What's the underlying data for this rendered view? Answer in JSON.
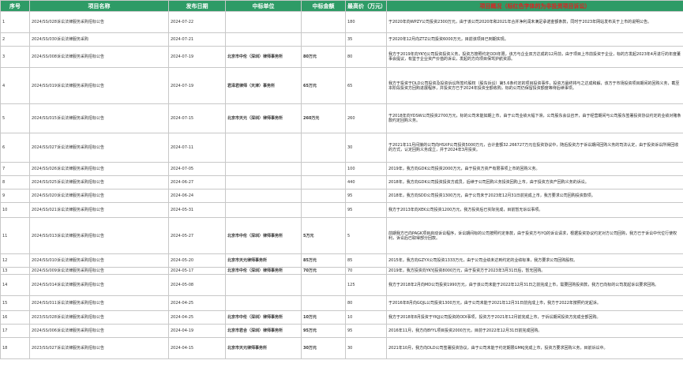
{
  "header": {
    "no": "序号",
    "name": "项目名称",
    "date": "发布日期",
    "winner": "中标单位",
    "amount": "中标金额",
    "price": "最高价（万元）",
    "summary": "项目概况（标红色字体的为非投资项目诉讼）"
  },
  "rows": [
    {
      "no": "1",
      "name": "2024/SS/028诉讼法律服务采购招标公告",
      "date": "2024-07-22",
      "winner": "",
      "amount": "",
      "price": "180",
      "summary": "于2020年向WPZY公司投资2300万元，由于该公司2020年和2021年合并净利润未满足承诺金额条款，同时于2023年网站发布关于上市的说明公告。"
    },
    {
      "no": "2",
      "name": "2024/SS/030诉讼法律服务采购",
      "date": "2024-07-21",
      "winner": "",
      "amount": "",
      "price": "35",
      "summary": "于2020年12月向ZTZ公司投资6000万元，目前该项目已到期实现。"
    },
    {
      "no": "3",
      "name": "2024/SS/008诉讼法律服务采购招标公告",
      "date": "2024-07-19",
      "winner": "北京市中伦（深圳）律师事务所",
      "amount": "80万元",
      "price": "80",
      "summary": "我方于2019年向YKYJ公司投资投资义务，投资方按照约定ODI年限，该方与企业双方达成的12月前，由于项目上市前投资于企业，标的方发起2023年4月进行的年度董事会提议，有鉴于企业资产价值的诉讼，发起的方向项目保驾护航资源。"
    },
    {
      "no": "4",
      "name": "2024/SS/019诉讼法律服务采购招标公告",
      "date": "2024-07-19",
      "winner": "君泽君律师（天津）事务所",
      "amount": "65万元",
      "price": "65",
      "summary": "我方于投资于DLD公司投资及投资诉讼所签约股权（股东诉讼）第5.6条约定的项目投资事件，投资方最终将与之达成和解，该方于市场投资项目期间的回购义务，截至本阶段投资方回购进展程序，并投资方已于2024年投资全额收购，标的公司仍保留投资额度等待后续事项。"
    },
    {
      "no": "5",
      "name": "2024/SS/015诉讼法律服务采购招标公告",
      "date": "2024-07-15",
      "winner": "北京市天元（深圳）律师事务所",
      "amount": "260万元",
      "price": "260",
      "summary": "于2018年向YDSW公司投资2700万元，标的公司未能如期上市，由于公司业绩大幅下滑，公司股东会议召开，由于经营期间与公司股东签署投资协议约定的业绩对赌条款约定回购义务。"
    },
    {
      "no": "6",
      "name": "2024/SS/027诉讼法律服务采购招标公告",
      "date": "2024-07-11",
      "winner": "",
      "amount": "",
      "price": "30",
      "summary": "于2021年11月间接的公司向HSXP公司投资5000万元，合计金额32.266727万元在投资协议中，随后投资方于诉讼期间回购义务的司法认定，由于投资诉讼所得回收的方式，认定回购义务成立，并于2024年3月投资。"
    },
    {
      "no": "7",
      "name": "2024/SS/026诉讼法律服务采购招标公告",
      "date": "2024-07-05",
      "winner": "",
      "amount": "",
      "price": "100",
      "summary": "2019年，我方向GDK公司投资2000万元，由于投资方资产有限事项上市的回购义务。"
    },
    {
      "no": "8",
      "name": "2024/SS/025诉讼法律服务采购招标公告",
      "date": "2024-06-27",
      "winner": "",
      "amount": "",
      "price": "440",
      "summary": "2018年，我方向GDK公司投资投资方成员，后续于公司回购义务投资回购上市，由于投资方资产回购义务的诉讼。"
    },
    {
      "no": "9",
      "name": "2024/SS/020诉讼法律服务采购招标公告",
      "date": "2024-06-24",
      "winner": "",
      "amount": "",
      "price": "95",
      "summary": "2018年，我方向SDD公司投资1300万元，由于公司未于2023年12月31日前完成上市，我方要求公司回购投资款项。"
    },
    {
      "no": "10",
      "name": "2024/SS/021诉讼法律服务采购招标公告",
      "date": "2024-05-31",
      "winner": "",
      "amount": "",
      "price": "95",
      "summary": "我方于2013年向XEK公司投资1200万元，我方投资后已实际完成，目前暂无诉讼事项。"
    },
    {
      "no": "11",
      "name": "2024/SS/013诉讼法律服务采购招标公告",
      "date": "2024-05-27",
      "winner": "北京市中伦（深圳）律师事务所",
      "amount": "5万元",
      "price": "5",
      "summary": "前期我方已向PAGK项目启动诉讼程序，诉讼期间标的公司按照约定条款，由于投资方与YQ的诉讼请求，根据投资协议约定对方公司回购，我方已于诉讼中代位行使权利，诉讼后已取得部分回款。"
    },
    {
      "no": "12",
      "name": "2024/SS/010诉讼法律服务采购招标公告",
      "date": "2024-05-20",
      "winner": "北京市天元律师事务所",
      "amount": "85万元",
      "price": "85",
      "summary": "2015年，我方向GZYX公司投资1333万元，由于公司业绩未达到约定的业绩标准，我方要求公司回购股权。"
    },
    {
      "no": "13",
      "name": "2024/SS/009诉讼法律服务采购招标公告",
      "date": "2024-05-17",
      "winner": "北京市中伦（深圳）律师事务所",
      "amount": "70万元",
      "price": "70",
      "summary": "2019年，我方投资向YKYJ投资8000万元，由于投资方于2023年3月31日后，暂无回购。"
    },
    {
      "no": "14",
      "name": "2024/SS/014诉讼法律服务采购招标公告",
      "date": "2024-05-08",
      "winner": "",
      "amount": "",
      "price": "125",
      "summary": "我方于2018年2月向MD公司投资1990万元，由于该公司未能于2022年12月31日之前完成上市，需要回购投资款，我方已向标的公司发起诉讼要求回购。"
    },
    {
      "no": "15",
      "name": "2024/SS/011诉讼法律服务采购招标公告",
      "date": "2024-04-25",
      "winner": "",
      "amount": "",
      "price": "80",
      "summary": "于2016年8月向GQJL公司投资1300万元，由于公司未能于2021年12月31日前完成上市，我方于2022年按照约定起诉。"
    },
    {
      "no": "16",
      "name": "2023/SS/028诉讼法律服务采购招标公告",
      "date": "2024-04-25",
      "winner": "北京市中伦（深圳）律师事务所",
      "amount": "10万元",
      "price": "10",
      "summary": "我方于2018年8月投资于YKJJ公司投资的ODI事项，投资方于2021年12月前完成上市，于诉讼期间投资方完成全部回购。"
    },
    {
      "no": "17",
      "name": "2024/SS/006诉讼法律服务采购招标公告",
      "date": "2024-04-19",
      "winner": "北京市君合（深圳）律师事务所",
      "amount": "95万元",
      "price": "95",
      "summary": "2016年11月，我方向BYYL项目投资2000万元，目前于2022年12月31日前完成回购。"
    },
    {
      "no": "18",
      "name": "2023/SS/027诉讼法律服务采购招标公告",
      "date": "2024-04-15",
      "winner": "北京市天元律师事务所",
      "amount": "30万元",
      "price": "30",
      "summary": "2021年10月，我方向DLD公司签署投资协议，由于公司未能于约定期限GMKJ完成上市，投资方要求回购义务，目前诉讼中。"
    }
  ]
}
